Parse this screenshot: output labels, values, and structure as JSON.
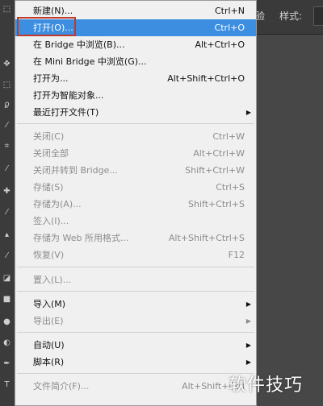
{
  "menu": {
    "items": [
      {
        "label": "新建(N)...",
        "shortcut": "Ctrl+N"
      },
      {
        "label": "打开(O)...",
        "shortcut": "Ctrl+O"
      },
      {
        "label": "在 Bridge 中浏览(B)...",
        "shortcut": "Alt+Ctrl+O"
      },
      {
        "label": "在 Mini Bridge 中浏览(G)...",
        "shortcut": ""
      },
      {
        "label": "打开为...",
        "shortcut": "Alt+Shift+Ctrl+O"
      },
      {
        "label": "打开为智能对象...",
        "shortcut": ""
      },
      {
        "label": "最近打开文件(T)",
        "shortcut": ""
      },
      {
        "label": "关闭(C)",
        "shortcut": "Ctrl+W"
      },
      {
        "label": "关闭全部",
        "shortcut": "Alt+Ctrl+W"
      },
      {
        "label": "关闭并转到 Bridge...",
        "shortcut": "Shift+Ctrl+W"
      },
      {
        "label": "存储(S)",
        "shortcut": "Ctrl+S"
      },
      {
        "label": "存储为(A)...",
        "shortcut": "Shift+Ctrl+S"
      },
      {
        "label": "签入(I)...",
        "shortcut": ""
      },
      {
        "label": "存储为 Web 所用格式...",
        "shortcut": "Alt+Shift+Ctrl+S"
      },
      {
        "label": "恢复(V)",
        "shortcut": "F12"
      },
      {
        "label": "置入(L)...",
        "shortcut": ""
      },
      {
        "label": "导入(M)",
        "shortcut": ""
      },
      {
        "label": "导出(E)",
        "shortcut": ""
      },
      {
        "label": "自动(U)",
        "shortcut": ""
      },
      {
        "label": "脚本(R)",
        "shortcut": ""
      },
      {
        "label": "文件简介(F)...",
        "shortcut": "Alt+Shift+Ctrl"
      }
    ]
  },
  "options_bar": {
    "partial_label": "验",
    "style_label": "样式:"
  },
  "watermark": "软件技巧",
  "colors": {
    "selected_bg": "#3d8ee0",
    "highlight_box": "#c0392b"
  }
}
